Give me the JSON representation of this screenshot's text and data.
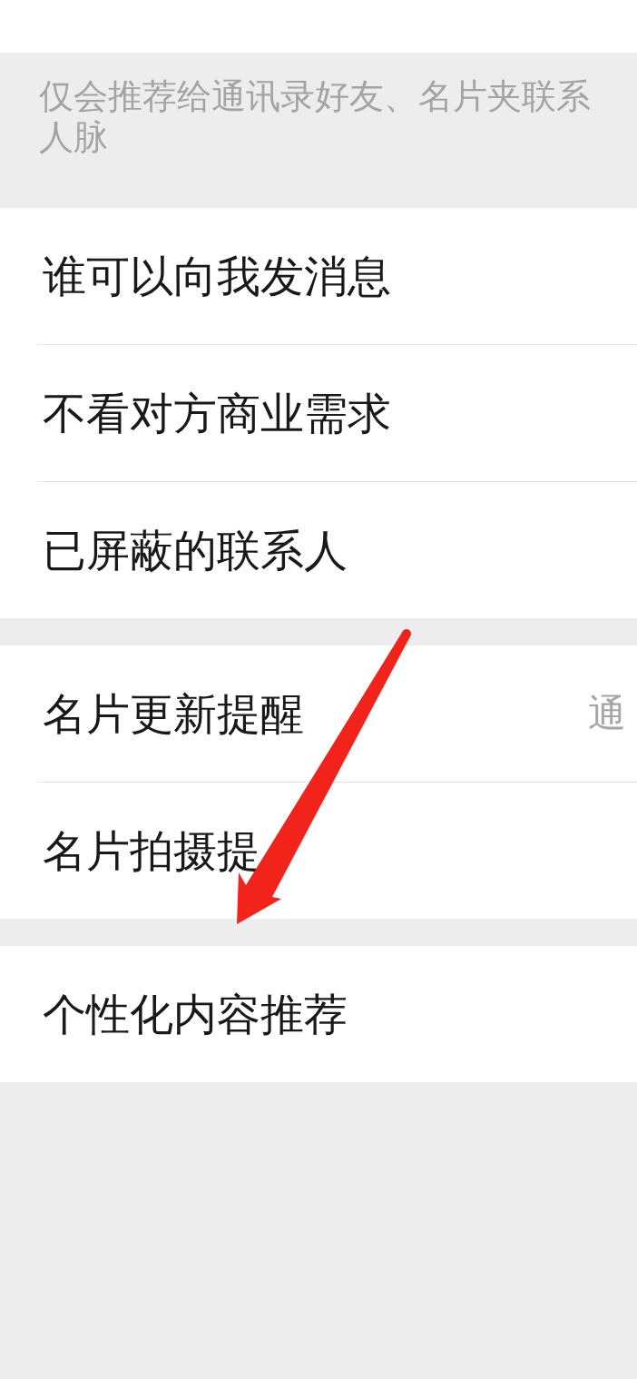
{
  "sections": [
    {
      "kind": "cut_row"
    },
    {
      "kind": "note",
      "lines": [
        "仅会推荐给通讯录好友、名片夹联系",
        "人脉"
      ]
    },
    {
      "kind": "group",
      "rows": [
        {
          "label": "谁可以向我发消息"
        },
        {
          "label": "不看对方商业需求"
        },
        {
          "label": "已屏蔽的联系人"
        }
      ]
    },
    {
      "kind": "group",
      "rows": [
        {
          "label": "名片更新提醒",
          "value": "通"
        },
        {
          "label": "名片拍摄提"
        }
      ]
    },
    {
      "kind": "group",
      "rows": [
        {
          "label": "个性化内容推荐"
        }
      ]
    }
  ],
  "annotations": [
    {
      "kind": "arrow"
    }
  ]
}
